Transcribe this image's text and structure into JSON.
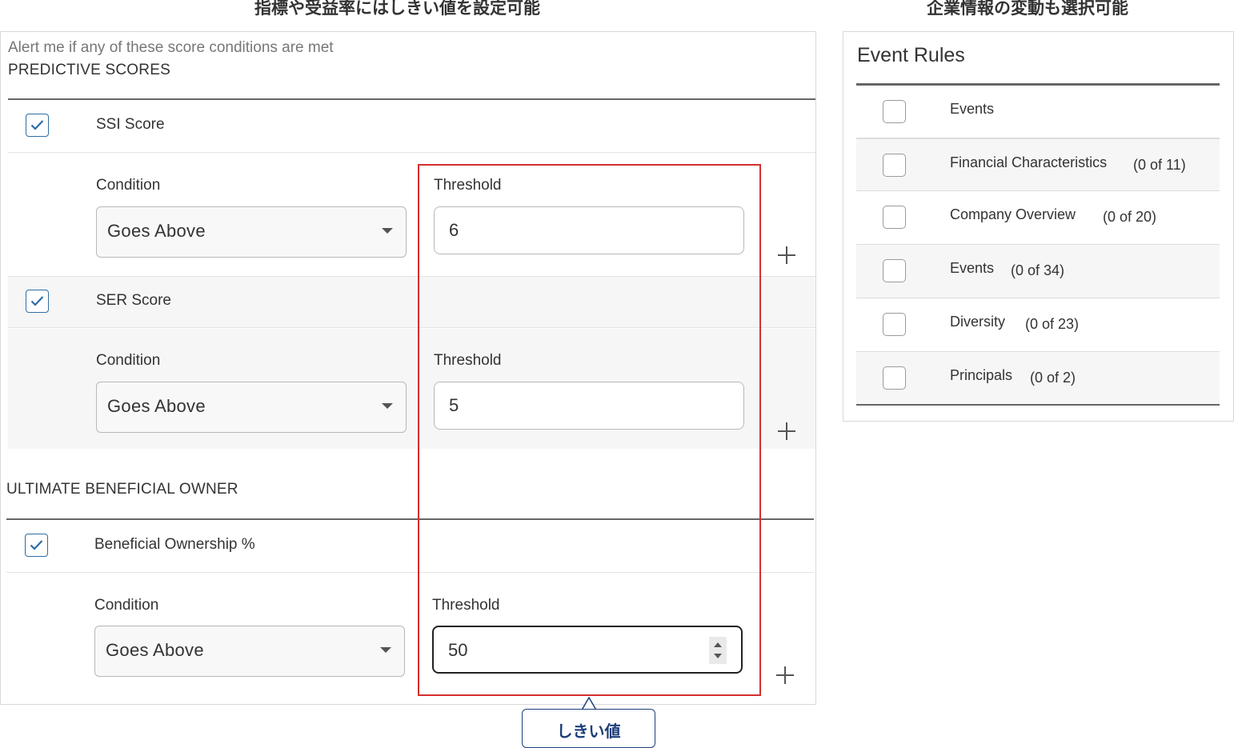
{
  "headings": {
    "left": "指標や受益率にはしきい値を設定可能",
    "right": "企業情報の変動も選択可能"
  },
  "alerts": {
    "intro": "Alert me if any of these score conditions are met",
    "predictive_title": "PREDICTIVE SCORES",
    "ubo_title": "ULTIMATE BENEFICIAL OWNER",
    "condition_label": "Condition",
    "threshold_label": "Threshold",
    "scores": [
      {
        "label": "SSI Score",
        "checked": true,
        "condition": "Goes Above",
        "threshold": "6"
      },
      {
        "label": "SER Score",
        "checked": true,
        "condition": "Goes Above",
        "threshold": "5"
      },
      {
        "label": "Beneficial Ownership %",
        "checked": true,
        "condition": "Goes Above",
        "threshold": "50"
      }
    ]
  },
  "callout": {
    "text": "しきい値"
  },
  "event_rules": {
    "title": "Event Rules",
    "rows": [
      {
        "label": "Events",
        "count": ""
      },
      {
        "label": "Financial Characteristics",
        "count": "(0 of 11)"
      },
      {
        "label": "Company Overview",
        "count": "(0 of 20)"
      },
      {
        "label": "Events",
        "count": "(0 of 34)"
      },
      {
        "label": "Diversity",
        "count": "(0 of 23)"
      },
      {
        "label": "Principals",
        "count": "(0 of 2)"
      }
    ]
  },
  "colors": {
    "checkbox_accent": "#2e6da4",
    "highlight": "#d32f2f",
    "callout": "#1d3f7a"
  }
}
